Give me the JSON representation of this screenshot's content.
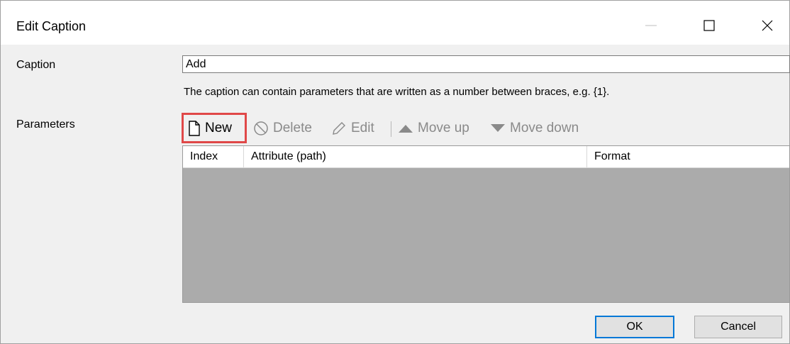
{
  "window": {
    "title": "Edit Caption",
    "controls": [
      "minimize",
      "maximize",
      "close"
    ]
  },
  "form": {
    "caption_label": "Caption",
    "caption_value": "Add",
    "hint": "The caption can contain parameters that are written as a number between braces, e.g. {1}.",
    "parameters_label": "Parameters"
  },
  "toolbar": {
    "new_label": "New",
    "delete_label": "Delete",
    "edit_label": "Edit",
    "move_up_label": "Move up",
    "move_down_label": "Move down"
  },
  "grid": {
    "columns": [
      "Index",
      "Attribute (path)",
      "Format"
    ],
    "rows": []
  },
  "buttons": {
    "ok_label": "OK",
    "cancel_label": "Cancel"
  },
  "colors": {
    "highlight": "#e04848",
    "ok_border": "#0078d7",
    "grid_background": "#ababab"
  }
}
